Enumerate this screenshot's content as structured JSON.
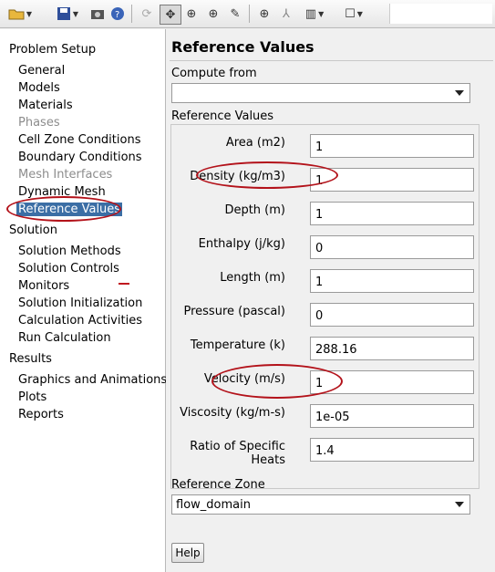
{
  "toolbar": {
    "icons": [
      "open-folder-icon",
      "save-disk-icon",
      "camera-icon",
      "help-circle-icon",
      "rotate-icon",
      "pan-move-icon",
      "zoom-fit-icon",
      "zoom-in-icon",
      "probe-icon",
      "zoom-box-icon",
      "axes-icon",
      "layout-icon",
      "window-icon"
    ]
  },
  "tree": {
    "problem_setup": "Problem Setup",
    "general": "General",
    "models": "Models",
    "materials": "Materials",
    "phases": "Phases",
    "cell_zone_conditions": "Cell Zone Conditions",
    "boundary_conditions": "Boundary Conditions",
    "mesh_interfaces": "Mesh Interfaces",
    "dynamic_mesh": "Dynamic Mesh",
    "reference_values": "Reference Values",
    "solution": "Solution",
    "solution_methods": "Solution Methods",
    "solution_controls": "Solution Controls",
    "monitors": "Monitors",
    "solution_initialization": "Solution Initialization",
    "calculation_activities": "Calculation Activities",
    "run_calculation": "Run Calculation",
    "results": "Results",
    "graphics_and_animations": "Graphics and Animations",
    "plots": "Plots",
    "reports": "Reports"
  },
  "panel": {
    "title": "Reference Values",
    "compute_from_label": "Compute from",
    "compute_from_value": "",
    "group_label": "Reference Values",
    "fields": [
      {
        "label": "Area (m2)",
        "value": "1"
      },
      {
        "label": "Density (kg/m3)",
        "value": "1"
      },
      {
        "label": "Depth (m)",
        "value": "1"
      },
      {
        "label": "Enthalpy (j/kg)",
        "value": "0"
      },
      {
        "label": "Length (m)",
        "value": "1"
      },
      {
        "label": "Pressure (pascal)",
        "value": "0"
      },
      {
        "label": "Temperature (k)",
        "value": "288.16"
      },
      {
        "label": "Velocity (m/s)",
        "value": "1"
      },
      {
        "label": "Viscosity (kg/m-s)",
        "value": "1e-05"
      },
      {
        "label": "Ratio of Specific Heats",
        "value": "1.4"
      }
    ],
    "reference_zone_label": "Reference Zone",
    "reference_zone_value": "flow_domain",
    "help_label": "Help"
  },
  "colors": {
    "selection": "#3b6ea5",
    "annotation": "#b3121a",
    "disabled_text": "#8c8c8c"
  }
}
